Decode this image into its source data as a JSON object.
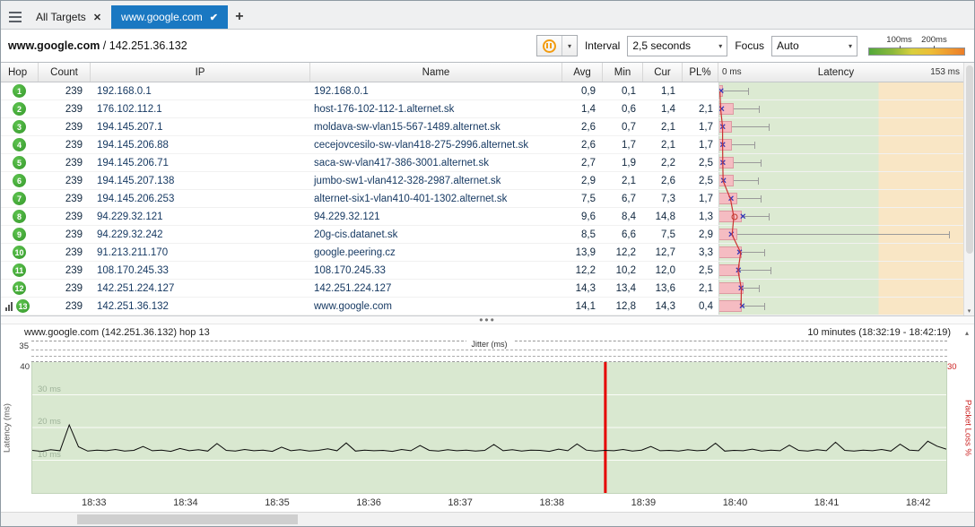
{
  "icons": {
    "close": "✕",
    "check": "✔",
    "cross": "✕",
    "dropdown": "▾",
    "up": "▴",
    "down": "▾",
    "dots": "•••"
  },
  "colors": {
    "accent_blue": "#1a78c2",
    "hop_green": "#3ea334",
    "graph_green": "#dcead2",
    "graph_orange": "#f9e6c5",
    "bar_pink": "#f5bcc2",
    "avg_line_red": "#cc3333",
    "packet_loss_red": "#e60000",
    "pause_orange": "#f29c11"
  },
  "tab_bar": {
    "tabs": [
      {
        "label": "All Targets",
        "active": false
      },
      {
        "label": "www.google.com",
        "active": true
      }
    ],
    "new_tab_label": "+"
  },
  "toolbar": {
    "target_host": "www.google.com",
    "target_separator": " / ",
    "target_ip": "142.251.36.132",
    "interval_label": "Interval",
    "interval_value": "2,5 seconds",
    "focus_label": "Focus",
    "focus_value": "Auto",
    "scale_legend": {
      "tick1": "100ms",
      "tick2": "200ms"
    }
  },
  "trace_table": {
    "columns": [
      "Hop",
      "Count",
      "IP",
      "Name",
      "Avg",
      "Min",
      "Cur",
      "PL%"
    ],
    "latency_scale": {
      "min_label": "0 ms",
      "title": "Latency",
      "max_label": "153 ms",
      "max_ms": 153,
      "green_zone_ms": 100
    },
    "rows": [
      {
        "hop": "1",
        "count": "239",
        "ip": "192.168.0.1",
        "name": "192.168.0.1",
        "avg": "0,9",
        "min": "0,1",
        "cur": "1,1",
        "pl": "",
        "focus": false,
        "g": {
          "bar": 2.5,
          "whisk": 18,
          "avg": 0.9,
          "cur": 1.1,
          "circle": false
        }
      },
      {
        "hop": "2",
        "count": "239",
        "ip": "176.102.112.1",
        "name": "host-176-102-112-1.alternet.sk",
        "avg": "1,4",
        "min": "0,6",
        "cur": "1,4",
        "pl": "2,1",
        "focus": false,
        "g": {
          "bar": 9,
          "whisk": 25,
          "avg": 1.4,
          "cur": 1.4,
          "circle": false
        }
      },
      {
        "hop": "3",
        "count": "239",
        "ip": "194.145.207.1",
        "name": "moldava-sw-vlan15-567-1489.alternet.sk",
        "avg": "2,6",
        "min": "0,7",
        "cur": "2,1",
        "pl": "1,7",
        "focus": false,
        "g": {
          "bar": 8,
          "whisk": 31,
          "avg": 2.6,
          "cur": 2.1,
          "circle": false
        }
      },
      {
        "hop": "4",
        "count": "239",
        "ip": "194.145.206.88",
        "name": "cecejovcesilo-sw-vlan418-275-2996.alternet.sk",
        "avg": "2,6",
        "min": "1,7",
        "cur": "2,1",
        "pl": "1,7",
        "focus": false,
        "g": {
          "bar": 8,
          "whisk": 22,
          "avg": 2.6,
          "cur": 2.1,
          "circle": false
        }
      },
      {
        "hop": "5",
        "count": "239",
        "ip": "194.145.206.71",
        "name": "saca-sw-vlan417-386-3001.alternet.sk",
        "avg": "2,7",
        "min": "1,9",
        "cur": "2,2",
        "pl": "2,5",
        "focus": false,
        "g": {
          "bar": 9,
          "whisk": 26,
          "avg": 2.7,
          "cur": 2.2,
          "circle": false
        }
      },
      {
        "hop": "6",
        "count": "239",
        "ip": "194.145.207.138",
        "name": "jumbo-sw1-vlan412-328-2987.alternet.sk",
        "avg": "2,9",
        "min": "2,1",
        "cur": "2,6",
        "pl": "2,5",
        "focus": false,
        "g": {
          "bar": 9,
          "whisk": 24,
          "avg": 2.9,
          "cur": 2.6,
          "circle": false
        }
      },
      {
        "hop": "7",
        "count": "239",
        "ip": "194.145.206.253",
        "name": "alternet-six1-vlan410-401-1302.alternet.sk",
        "avg": "7,5",
        "min": "6,7",
        "cur": "7,3",
        "pl": "1,7",
        "focus": false,
        "g": {
          "bar": 11,
          "whisk": 26,
          "avg": 7.5,
          "cur": 7.3,
          "circle": false
        }
      },
      {
        "hop": "8",
        "count": "239",
        "ip": "94.229.32.121",
        "name": "94.229.32.121",
        "avg": "9,6",
        "min": "8,4",
        "cur": "14,8",
        "pl": "1,3",
        "focus": false,
        "g": {
          "bar": 14,
          "whisk": 31,
          "avg": 9.6,
          "cur": 14.8,
          "circle": true
        }
      },
      {
        "hop": "9",
        "count": "239",
        "ip": "94.229.32.242",
        "name": "20g-cis.datanet.sk",
        "avg": "8,5",
        "min": "6,6",
        "cur": "7,5",
        "pl": "2,9",
        "focus": false,
        "g": {
          "bar": 11,
          "whisk": 144,
          "avg": 8.5,
          "cur": 7.5,
          "circle": false
        }
      },
      {
        "hop": "10",
        "count": "239",
        "ip": "91.213.211.170",
        "name": "google.peering.cz",
        "avg": "13,9",
        "min": "12,2",
        "cur": "12,7",
        "pl": "3,3",
        "focus": false,
        "g": {
          "bar": 14,
          "whisk": 28,
          "avg": 13.9,
          "cur": 12.7,
          "circle": false
        }
      },
      {
        "hop": "11",
        "count": "239",
        "ip": "108.170.245.33",
        "name": "108.170.245.33",
        "avg": "12,2",
        "min": "10,2",
        "cur": "12,0",
        "pl": "2,5",
        "focus": false,
        "g": {
          "bar": 13,
          "whisk": 32,
          "avg": 12.2,
          "cur": 12.0,
          "circle": false
        }
      },
      {
        "hop": "12",
        "count": "239",
        "ip": "142.251.224.127",
        "name": "142.251.224.127",
        "avg": "14,3",
        "min": "13,4",
        "cur": "13,6",
        "pl": "2,1",
        "focus": false,
        "g": {
          "bar": 15,
          "whisk": 25,
          "avg": 14.3,
          "cur": 13.6,
          "circle": false
        }
      },
      {
        "hop": "13",
        "count": "239",
        "ip": "142.251.36.132",
        "name": "www.google.com",
        "avg": "14,1",
        "min": "12,8",
        "cur": "14,3",
        "pl": "0,4",
        "focus": true,
        "g": {
          "bar": 14,
          "whisk": 28,
          "avg": 14.1,
          "cur": 14.3,
          "circle": false
        }
      }
    ]
  },
  "timeline": {
    "title": "www.google.com (142.251.36.132) hop 13",
    "range_label": "10 minutes (18:32:19 - 18:42:19)",
    "jitter": {
      "label": "Jitter (ms)",
      "top_label": "35"
    },
    "left_axis": {
      "label": "Latency (ms)",
      "top_label": "40",
      "gridlines": [
        "30 ms",
        "20 ms",
        "10 ms"
      ]
    },
    "right_axis": {
      "label": "Packet Loss %",
      "top_label": "30"
    }
  },
  "chart_data": {
    "type": "line",
    "title": "www.google.com (142.251.36.132) hop 13",
    "xlabel": "",
    "ylabel_left": "Latency (ms)",
    "ylabel_right": "Packet Loss %",
    "ylim_left": [
      0,
      40
    ],
    "ylim_right": [
      0,
      30
    ],
    "x_ticks": [
      "18:33",
      "18:34",
      "18:35",
      "18:36",
      "18:37",
      "18:38",
      "18:39",
      "18:40",
      "18:41",
      "18:42"
    ],
    "time_span_seconds": 600,
    "first_tick_offset_seconds": 41,
    "packet_loss_event_fraction": 0.627,
    "latency_series": [
      13.0,
      12.7,
      13.2,
      12.9,
      20.8,
      14.1,
      12.8,
      13.1,
      12.9,
      13.3,
      12.8,
      13.0,
      14.2,
      12.9,
      13.1,
      12.7,
      13.6,
      12.9,
      13.2,
      12.8,
      15.1,
      13.0,
      12.8,
      13.3,
      12.9,
      13.1,
      12.7,
      14.0,
      12.9,
      13.2,
      12.8,
      13.0,
      13.5,
      12.9,
      15.3,
      12.8,
      13.1,
      12.9,
      13.0,
      12.7,
      13.3,
      12.9,
      14.5,
      13.0,
      12.8,
      13.2,
      12.9,
      13.1,
      12.8,
      13.0,
      14.8,
      12.9,
      13.2,
      12.8,
      13.1,
      13.0,
      12.7,
      13.4,
      12.9,
      15.0,
      13.1,
      12.8,
      13.0,
      12.9,
      13.3,
      12.8,
      13.1,
      14.2,
      12.9,
      13.0,
      12.8,
      13.2,
      12.9,
      13.1,
      15.2,
      12.8,
      13.0,
      12.9,
      13.4,
      12.8,
      13.1,
      12.9,
      14.6,
      13.0,
      12.8,
      13.2,
      12.9,
      15.5,
      13.0,
      12.8,
      13.1,
      12.9,
      13.3,
      12.8,
      14.9,
      13.1,
      12.9,
      15.8,
      14.3,
      13.4
    ]
  }
}
